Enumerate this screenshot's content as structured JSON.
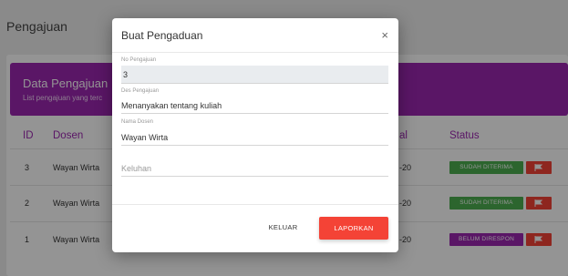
{
  "page": {
    "title": "Pengajuan",
    "card_title": "Data Pengajuan",
    "card_subtitle": "List pengajuan yang terc"
  },
  "table": {
    "headers": {
      "id": "ID",
      "dosen": "Dosen",
      "tanggal": "al",
      "status": "Status"
    },
    "rows": [
      {
        "id": "3",
        "dosen": "Wayan Wirta",
        "date_tail": "-20",
        "status": "SUDAH DITERIMA",
        "status_color": "#4caf50"
      },
      {
        "id": "2",
        "dosen": "Wayan Wirta",
        "date_tail": "-20",
        "status": "SUDAH DITERIMA",
        "status_color": "#4caf50"
      },
      {
        "id": "1",
        "dosen": "Wayan Wirta",
        "date_tail": "-20",
        "status": "BELUM DIRESPON",
        "status_color": "#9c27b0"
      }
    ],
    "flag_icon": "flag-icon"
  },
  "modal": {
    "title": "Buat Pengaduan",
    "close_symbol": "×",
    "fields": {
      "no_label": "No Pengajuan",
      "no_value": "3",
      "des_label": "Des Pengajuan",
      "des_value": "Menanyakan tentang kuliah",
      "dosen_label": "Nama Dosen",
      "dosen_value": "Wayan Wirta",
      "keluhan_placeholder": "Keluhan"
    },
    "keluar_label": "KELUAR",
    "laporkan_label": "LAPORKAN"
  },
  "colors": {
    "accent": "#9c27b0",
    "danger": "#f44336",
    "success": "#4caf50"
  }
}
